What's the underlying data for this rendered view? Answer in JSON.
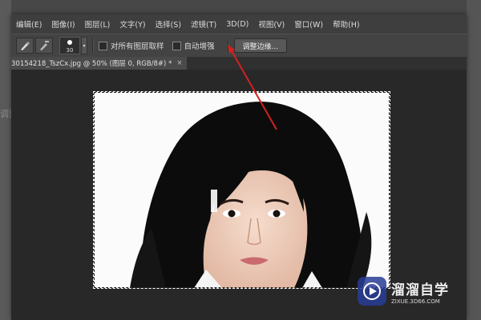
{
  "backdrop": {
    "left_fragment": "调整"
  },
  "menubar": {
    "items": [
      "编辑(E)",
      "图像(I)",
      "图层(L)",
      "文字(Y)",
      "选择(S)",
      "滤镜(T)",
      "3D(D)",
      "视图(V)",
      "窗口(W)",
      "帮助(H)"
    ]
  },
  "options": {
    "brush_size": "30",
    "sample_all_layers": "对所有图层取样",
    "auto_enhance": "自动增强",
    "refine_edge": "调整边缘..."
  },
  "document": {
    "tab_title": "30154218_TszCx.jpg @ 50% (图层 0, RGB/8#) *",
    "close": "×"
  },
  "watermark": {
    "title": "溜溜自学",
    "subtitle": "ZIXUE.3D66.COM"
  },
  "colors": {
    "arrow": "#d42020",
    "menubar": "#3e3e3e",
    "workspace": "#282828"
  }
}
